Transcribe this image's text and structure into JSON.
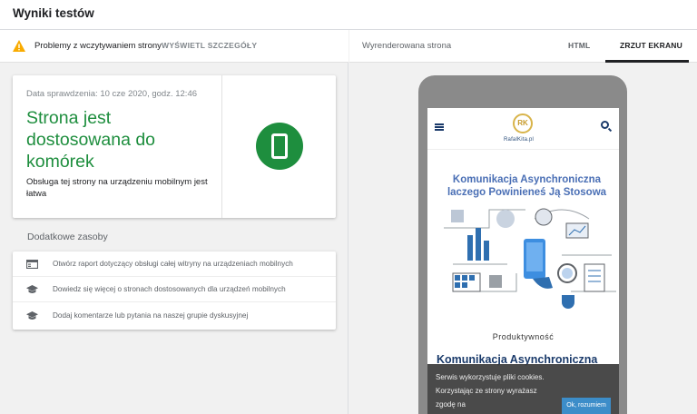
{
  "topbar": {
    "title": "Wyniki testów"
  },
  "warning": {
    "text": "Problemy z wczytywaniem strony",
    "link": "WYŚWIETL SZCZEGÓŁY"
  },
  "result": {
    "date": "Data sprawdzenia: 10 cze 2020, godz. 12:46",
    "headline": "Strona jest dostosowana do komórek",
    "description": "Obsługa tej strony na urządzeniu mobilnym jest łatwa"
  },
  "resources": {
    "heading": "Dodatkowe zasoby",
    "items": [
      {
        "icon": "report-icon",
        "label": "Otwórz raport dotyczący obsługi całej witryny na urządzeniach mobilnych"
      },
      {
        "icon": "school-icon",
        "label": "Dowiedz się więcej o stronach dostosowanych dla urządzeń mobilnych"
      },
      {
        "icon": "school-icon",
        "label": "Dodaj komentarze lub pytania na naszej grupie dyskusyjnej"
      }
    ]
  },
  "rightpane": {
    "title": "Wyrenderowana strona",
    "tabs": {
      "html": "HTML",
      "screenshot": "ZRZUT EKRANU"
    }
  },
  "preview": {
    "logo_initials": "RK",
    "logo_text": "RafalKita.pl",
    "hero_title_line1": "Komunikacja Asynchroniczna",
    "hero_title_line2": "laczego Powinieneś Ją Stosowa",
    "category": "Produktywność",
    "post_title": "Komunikacja Asynchroniczna",
    "cookie_text": "Serwis wykorzystuje pliki cookies. Korzystając ze strony wyrażasz zgodę na",
    "cookie_button": "Ok, rozumiem"
  },
  "colors": {
    "success": "#1e8e3e",
    "warning": "#f9ab00",
    "device": "#8a8a8a"
  }
}
